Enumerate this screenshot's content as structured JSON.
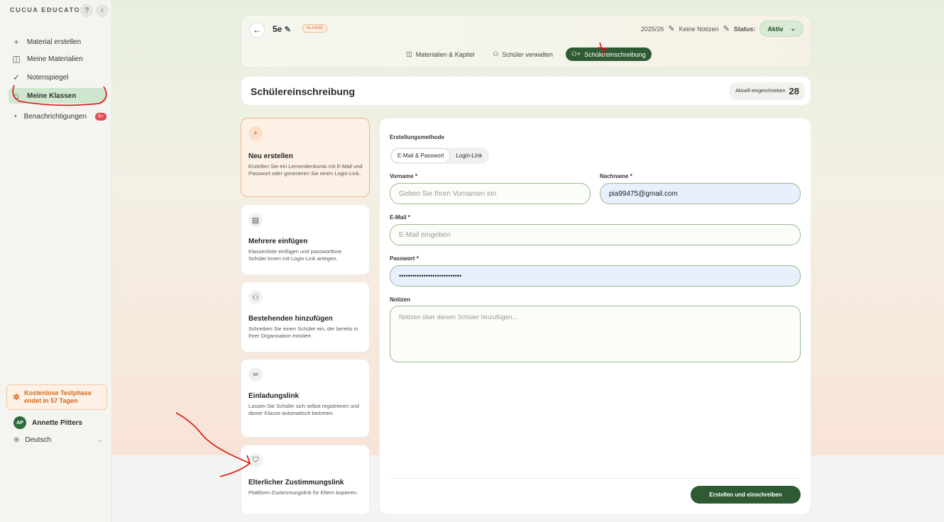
{
  "sidebar": {
    "brand": "CUCUA EDUCATOR",
    "help_icon": "?",
    "collapse_icon": "‹",
    "items": [
      {
        "icon": "+",
        "label": "Material erstellen"
      },
      {
        "icon": "◫",
        "label": "Meine Materialien"
      },
      {
        "icon": "✓",
        "label": "Notenspiegel"
      },
      {
        "icon": "⌂",
        "label": "Meine Klassen"
      },
      {
        "icon": "◔",
        "label": "Benachrichtigungen",
        "badge": "9+"
      }
    ],
    "trial": {
      "line1": "Kostenlose Testphase",
      "line2": "endet in 57 Tagen"
    },
    "user": {
      "initials": "AP",
      "name": "Annette Pitters"
    },
    "language": "Deutsch"
  },
  "header": {
    "class_name": "5e",
    "tag": "KLASSE",
    "year": "2025/26",
    "notes": "Keine Notizen",
    "status_label": "Status:",
    "status_value": "Aktiv",
    "tabs": [
      {
        "icon": "◫",
        "label": "Materialien & Kapitel"
      },
      {
        "icon": "⚇",
        "label": "Schüler verwalten"
      },
      {
        "icon": "⚇+",
        "label": "Schülereinschreibung"
      }
    ]
  },
  "page": {
    "title": "Schülereinschreibung",
    "enrolled_label": "Aktuell eingeschrieben",
    "enrolled_count": "28"
  },
  "methods": [
    {
      "icon": "+",
      "title": "Neu erstellen",
      "desc": "Erstellen Sie ein Lernendenkonto mit E-Mail und Passwort oder generieren Sie einen Login-Link."
    },
    {
      "icon": "▤",
      "title": "Mehrere einfügen",
      "desc": "Klassenliste einfügen und passwortlose Schüler:innen mit Login-Link anlegen."
    },
    {
      "icon": "⚇",
      "title": "Bestehenden hinzufügen",
      "desc": "Schreiben Sie einen Schüler ein, der bereits in Ihrer Organisation existiert."
    },
    {
      "icon": "∞",
      "title": "Einladungslink",
      "desc": "Lassen Sie Schüler sich selbst registrieren und dieser Klasse automatisch beitreten."
    },
    {
      "icon": "⛉",
      "title": "Elterlicher Zustimmungslink",
      "desc": "Plattform-Zustimmungslink für Eltern kopieren."
    }
  ],
  "form": {
    "method_label": "Erstellungsmethode",
    "method_options": [
      "E-Mail & Passwort",
      "Login-Link"
    ],
    "vorname_label": "Vorname *",
    "vorname_placeholder": "Geben Sie Ihren Vornamen ein",
    "nachname_label": "Nachname *",
    "nachname_value": "pia99475@gmail.com",
    "email_label": "E-Mail *",
    "email_placeholder": "E-Mail eingeben",
    "password_label": "Passwort *",
    "password_value": "••••••••••••••••••••••••••••",
    "notes_label": "Notizen",
    "notes_placeholder": "Notizen über diesen Schüler hinzufügen...",
    "submit": "Erstellen und einschreiben"
  }
}
